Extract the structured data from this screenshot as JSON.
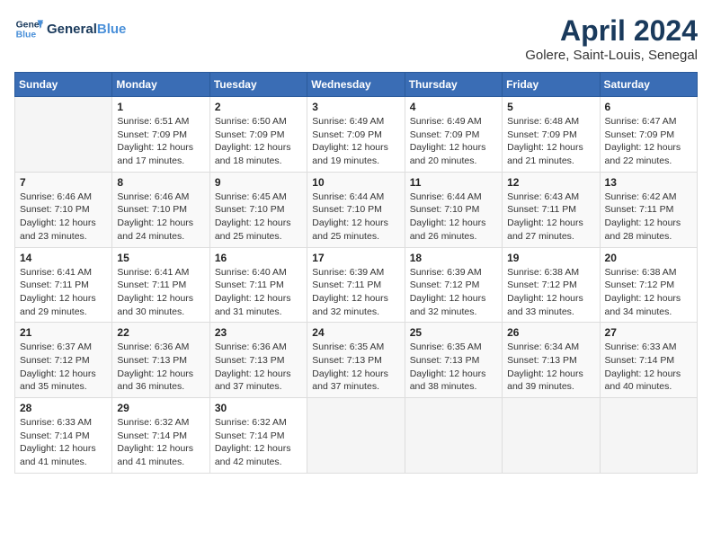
{
  "logo": {
    "line1": "General",
    "line2": "Blue"
  },
  "title": {
    "month_year": "April 2024",
    "location": "Golere, Saint-Louis, Senegal"
  },
  "weekdays": [
    "Sunday",
    "Monday",
    "Tuesday",
    "Wednesday",
    "Thursday",
    "Friday",
    "Saturday"
  ],
  "weeks": [
    [
      {
        "day": "",
        "sunrise": "",
        "sunset": "",
        "daylight": ""
      },
      {
        "day": "1",
        "sunrise": "Sunrise: 6:51 AM",
        "sunset": "Sunset: 7:09 PM",
        "daylight": "Daylight: 12 hours and 17 minutes."
      },
      {
        "day": "2",
        "sunrise": "Sunrise: 6:50 AM",
        "sunset": "Sunset: 7:09 PM",
        "daylight": "Daylight: 12 hours and 18 minutes."
      },
      {
        "day": "3",
        "sunrise": "Sunrise: 6:49 AM",
        "sunset": "Sunset: 7:09 PM",
        "daylight": "Daylight: 12 hours and 19 minutes."
      },
      {
        "day": "4",
        "sunrise": "Sunrise: 6:49 AM",
        "sunset": "Sunset: 7:09 PM",
        "daylight": "Daylight: 12 hours and 20 minutes."
      },
      {
        "day": "5",
        "sunrise": "Sunrise: 6:48 AM",
        "sunset": "Sunset: 7:09 PM",
        "daylight": "Daylight: 12 hours and 21 minutes."
      },
      {
        "day": "6",
        "sunrise": "Sunrise: 6:47 AM",
        "sunset": "Sunset: 7:09 PM",
        "daylight": "Daylight: 12 hours and 22 minutes."
      }
    ],
    [
      {
        "day": "7",
        "sunrise": "Sunrise: 6:46 AM",
        "sunset": "Sunset: 7:10 PM",
        "daylight": "Daylight: 12 hours and 23 minutes."
      },
      {
        "day": "8",
        "sunrise": "Sunrise: 6:46 AM",
        "sunset": "Sunset: 7:10 PM",
        "daylight": "Daylight: 12 hours and 24 minutes."
      },
      {
        "day": "9",
        "sunrise": "Sunrise: 6:45 AM",
        "sunset": "Sunset: 7:10 PM",
        "daylight": "Daylight: 12 hours and 25 minutes."
      },
      {
        "day": "10",
        "sunrise": "Sunrise: 6:44 AM",
        "sunset": "Sunset: 7:10 PM",
        "daylight": "Daylight: 12 hours and 25 minutes."
      },
      {
        "day": "11",
        "sunrise": "Sunrise: 6:44 AM",
        "sunset": "Sunset: 7:10 PM",
        "daylight": "Daylight: 12 hours and 26 minutes."
      },
      {
        "day": "12",
        "sunrise": "Sunrise: 6:43 AM",
        "sunset": "Sunset: 7:11 PM",
        "daylight": "Daylight: 12 hours and 27 minutes."
      },
      {
        "day": "13",
        "sunrise": "Sunrise: 6:42 AM",
        "sunset": "Sunset: 7:11 PM",
        "daylight": "Daylight: 12 hours and 28 minutes."
      }
    ],
    [
      {
        "day": "14",
        "sunrise": "Sunrise: 6:41 AM",
        "sunset": "Sunset: 7:11 PM",
        "daylight": "Daylight: 12 hours and 29 minutes."
      },
      {
        "day": "15",
        "sunrise": "Sunrise: 6:41 AM",
        "sunset": "Sunset: 7:11 PM",
        "daylight": "Daylight: 12 hours and 30 minutes."
      },
      {
        "day": "16",
        "sunrise": "Sunrise: 6:40 AM",
        "sunset": "Sunset: 7:11 PM",
        "daylight": "Daylight: 12 hours and 31 minutes."
      },
      {
        "day": "17",
        "sunrise": "Sunrise: 6:39 AM",
        "sunset": "Sunset: 7:11 PM",
        "daylight": "Daylight: 12 hours and 32 minutes."
      },
      {
        "day": "18",
        "sunrise": "Sunrise: 6:39 AM",
        "sunset": "Sunset: 7:12 PM",
        "daylight": "Daylight: 12 hours and 32 minutes."
      },
      {
        "day": "19",
        "sunrise": "Sunrise: 6:38 AM",
        "sunset": "Sunset: 7:12 PM",
        "daylight": "Daylight: 12 hours and 33 minutes."
      },
      {
        "day": "20",
        "sunrise": "Sunrise: 6:38 AM",
        "sunset": "Sunset: 7:12 PM",
        "daylight": "Daylight: 12 hours and 34 minutes."
      }
    ],
    [
      {
        "day": "21",
        "sunrise": "Sunrise: 6:37 AM",
        "sunset": "Sunset: 7:12 PM",
        "daylight": "Daylight: 12 hours and 35 minutes."
      },
      {
        "day": "22",
        "sunrise": "Sunrise: 6:36 AM",
        "sunset": "Sunset: 7:13 PM",
        "daylight": "Daylight: 12 hours and 36 minutes."
      },
      {
        "day": "23",
        "sunrise": "Sunrise: 6:36 AM",
        "sunset": "Sunset: 7:13 PM",
        "daylight": "Daylight: 12 hours and 37 minutes."
      },
      {
        "day": "24",
        "sunrise": "Sunrise: 6:35 AM",
        "sunset": "Sunset: 7:13 PM",
        "daylight": "Daylight: 12 hours and 37 minutes."
      },
      {
        "day": "25",
        "sunrise": "Sunrise: 6:35 AM",
        "sunset": "Sunset: 7:13 PM",
        "daylight": "Daylight: 12 hours and 38 minutes."
      },
      {
        "day": "26",
        "sunrise": "Sunrise: 6:34 AM",
        "sunset": "Sunset: 7:13 PM",
        "daylight": "Daylight: 12 hours and 39 minutes."
      },
      {
        "day": "27",
        "sunrise": "Sunrise: 6:33 AM",
        "sunset": "Sunset: 7:14 PM",
        "daylight": "Daylight: 12 hours and 40 minutes."
      }
    ],
    [
      {
        "day": "28",
        "sunrise": "Sunrise: 6:33 AM",
        "sunset": "Sunset: 7:14 PM",
        "daylight": "Daylight: 12 hours and 41 minutes."
      },
      {
        "day": "29",
        "sunrise": "Sunrise: 6:32 AM",
        "sunset": "Sunset: 7:14 PM",
        "daylight": "Daylight: 12 hours and 41 minutes."
      },
      {
        "day": "30",
        "sunrise": "Sunrise: 6:32 AM",
        "sunset": "Sunset: 7:14 PM",
        "daylight": "Daylight: 12 hours and 42 minutes."
      },
      {
        "day": "",
        "sunrise": "",
        "sunset": "",
        "daylight": ""
      },
      {
        "day": "",
        "sunrise": "",
        "sunset": "",
        "daylight": ""
      },
      {
        "day": "",
        "sunrise": "",
        "sunset": "",
        "daylight": ""
      },
      {
        "day": "",
        "sunrise": "",
        "sunset": "",
        "daylight": ""
      }
    ]
  ]
}
